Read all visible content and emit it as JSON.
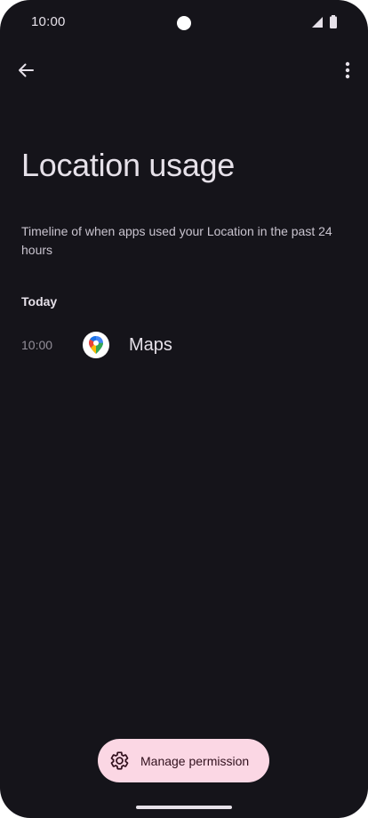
{
  "status_bar": {
    "time": "10:00",
    "icons": [
      "camera-cutout",
      "signal-icon",
      "battery-icon"
    ]
  },
  "app_bar": {
    "back_icon": "arrow-back-icon",
    "menu_icon": "more-vert-icon"
  },
  "page": {
    "title": "Location usage",
    "description": "Timeline of when apps used your Location in the past 24 hours"
  },
  "timeline": {
    "section_label": "Today",
    "entries": [
      {
        "time": "10:00",
        "app_name": "Maps",
        "icon": "google-maps-icon"
      }
    ]
  },
  "fab": {
    "label": "Manage permission",
    "icon": "gear-icon"
  },
  "colors": {
    "background": "#15141a",
    "text_primary": "#e6e1e9",
    "text_secondary": "#c9c4cf",
    "text_muted": "#938f99",
    "fab_background": "#fbd7e4",
    "fab_text": "#31101d"
  }
}
